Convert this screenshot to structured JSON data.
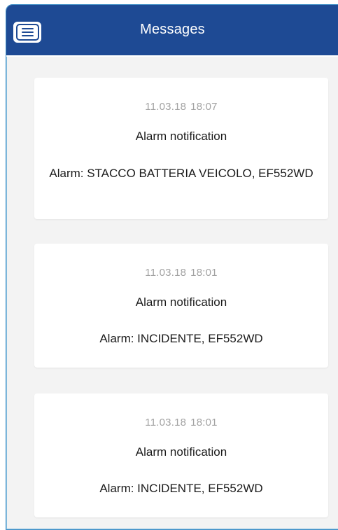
{
  "header": {
    "title": "Messages",
    "menu_icon": "menu-icon",
    "colors": {
      "bar": "#1e4a94",
      "background": "#f3f3f3",
      "card": "#ffffff",
      "date_text": "#a3a3a3",
      "text": "#1b1b1b"
    }
  },
  "messages": [
    {
      "date": "11.03.18",
      "time": "18:07",
      "subject": "Alarm notification",
      "body": "Alarm: STACCO BATTERIA VEICOLO, EF552WD"
    },
    {
      "date": "11.03.18",
      "time": "18:01",
      "subject": "Alarm notification",
      "body": "Alarm: INCIDENTE, EF552WD"
    },
    {
      "date": "11.03.18",
      "time": "18:01",
      "subject": "Alarm notification",
      "body": "Alarm: INCIDENTE, EF552WD"
    }
  ]
}
